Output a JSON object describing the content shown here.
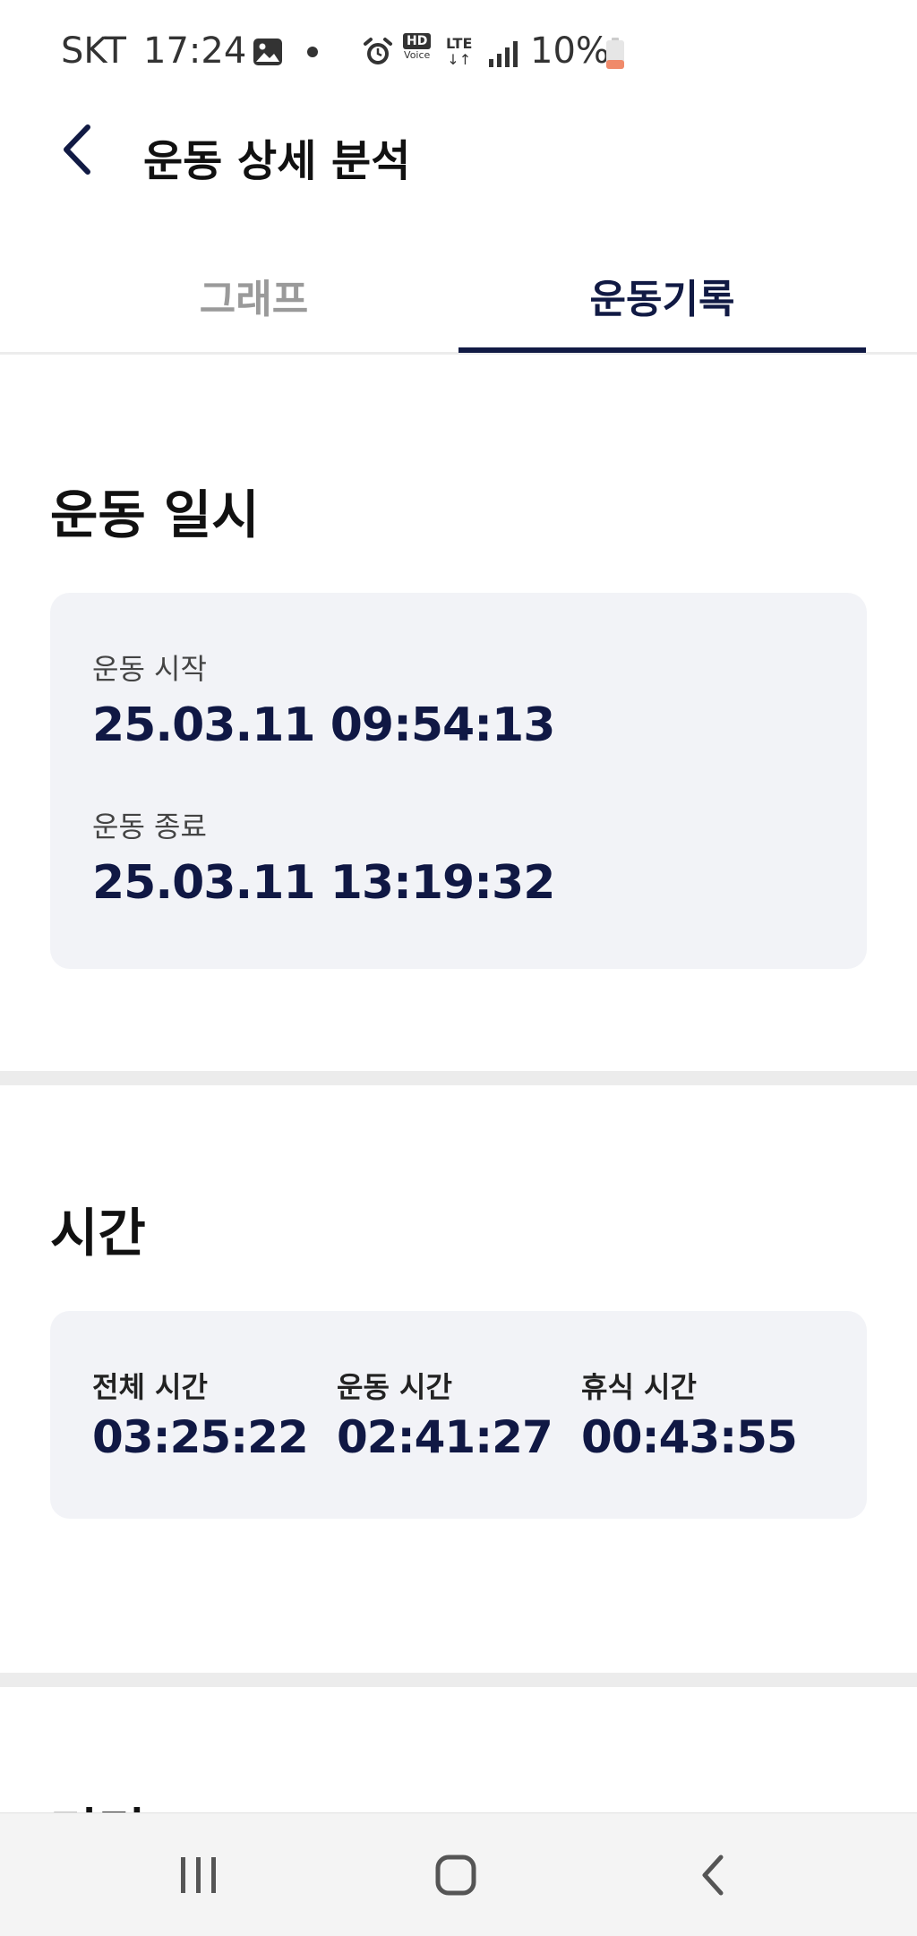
{
  "status_bar": {
    "carrier": "SKT",
    "time": "17:24",
    "hd_label": "HD",
    "voice_label": "Voice",
    "network": "LTE",
    "battery_percent": "10%",
    "icons": [
      "gallery-icon",
      "dot-icon",
      "alarm-icon",
      "hd-voice-icon",
      "lte-icon",
      "signal-icon",
      "battery-icon"
    ],
    "battery_color": "#f08a6a"
  },
  "header": {
    "title": "운동 상세 분석"
  },
  "tabs": [
    {
      "label": "그래프",
      "active": false
    },
    {
      "label": "운동기록",
      "active": true
    }
  ],
  "sections": {
    "datetime": {
      "title": "운동 일시",
      "start_label": "운동 시작",
      "start_value": "25.03.11 09:54:13",
      "end_label": "운동 종료",
      "end_value": "25.03.11 13:19:32"
    },
    "time": {
      "title": "시간",
      "items": [
        {
          "label": "전체 시간",
          "value": "03:25:22"
        },
        {
          "label": "운동 시간",
          "value": "02:41:27"
        },
        {
          "label": "휴식 시간",
          "value": "00:43:55"
        }
      ]
    },
    "next": {
      "title": "거리"
    }
  },
  "colors": {
    "accent": "#111a44",
    "card_background": "#f2f3f7",
    "divider": "#ececec",
    "inactive_tab": "#9a9a9a"
  },
  "nav_bar": {
    "icons": [
      "recent-apps-icon",
      "home-icon",
      "back-icon"
    ]
  }
}
